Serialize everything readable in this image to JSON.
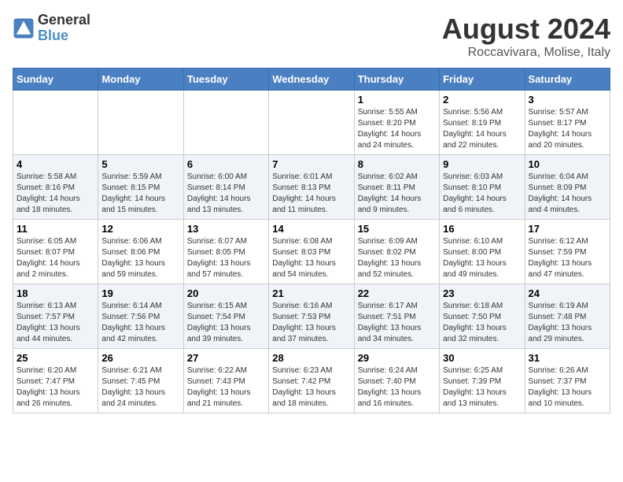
{
  "logo": {
    "text_general": "General",
    "text_blue": "Blue"
  },
  "header": {
    "title": "August 2024",
    "subtitle": "Roccavivara, Molise, Italy"
  },
  "columns": [
    "Sunday",
    "Monday",
    "Tuesday",
    "Wednesday",
    "Thursday",
    "Friday",
    "Saturday"
  ],
  "weeks": [
    [
      {
        "day": "",
        "info": ""
      },
      {
        "day": "",
        "info": ""
      },
      {
        "day": "",
        "info": ""
      },
      {
        "day": "",
        "info": ""
      },
      {
        "day": "1",
        "info": "Sunrise: 5:55 AM\nSunset: 8:20 PM\nDaylight: 14 hours\nand 24 minutes."
      },
      {
        "day": "2",
        "info": "Sunrise: 5:56 AM\nSunset: 8:19 PM\nDaylight: 14 hours\nand 22 minutes."
      },
      {
        "day": "3",
        "info": "Sunrise: 5:57 AM\nSunset: 8:17 PM\nDaylight: 14 hours\nand 20 minutes."
      }
    ],
    [
      {
        "day": "4",
        "info": "Sunrise: 5:58 AM\nSunset: 8:16 PM\nDaylight: 14 hours\nand 18 minutes."
      },
      {
        "day": "5",
        "info": "Sunrise: 5:59 AM\nSunset: 8:15 PM\nDaylight: 14 hours\nand 15 minutes."
      },
      {
        "day": "6",
        "info": "Sunrise: 6:00 AM\nSunset: 8:14 PM\nDaylight: 14 hours\nand 13 minutes."
      },
      {
        "day": "7",
        "info": "Sunrise: 6:01 AM\nSunset: 8:13 PM\nDaylight: 14 hours\nand 11 minutes."
      },
      {
        "day": "8",
        "info": "Sunrise: 6:02 AM\nSunset: 8:11 PM\nDaylight: 14 hours\nand 9 minutes."
      },
      {
        "day": "9",
        "info": "Sunrise: 6:03 AM\nSunset: 8:10 PM\nDaylight: 14 hours\nand 6 minutes."
      },
      {
        "day": "10",
        "info": "Sunrise: 6:04 AM\nSunset: 8:09 PM\nDaylight: 14 hours\nand 4 minutes."
      }
    ],
    [
      {
        "day": "11",
        "info": "Sunrise: 6:05 AM\nSunset: 8:07 PM\nDaylight: 14 hours\nand 2 minutes."
      },
      {
        "day": "12",
        "info": "Sunrise: 6:06 AM\nSunset: 8:06 PM\nDaylight: 13 hours\nand 59 minutes."
      },
      {
        "day": "13",
        "info": "Sunrise: 6:07 AM\nSunset: 8:05 PM\nDaylight: 13 hours\nand 57 minutes."
      },
      {
        "day": "14",
        "info": "Sunrise: 6:08 AM\nSunset: 8:03 PM\nDaylight: 13 hours\nand 54 minutes."
      },
      {
        "day": "15",
        "info": "Sunrise: 6:09 AM\nSunset: 8:02 PM\nDaylight: 13 hours\nand 52 minutes."
      },
      {
        "day": "16",
        "info": "Sunrise: 6:10 AM\nSunset: 8:00 PM\nDaylight: 13 hours\nand 49 minutes."
      },
      {
        "day": "17",
        "info": "Sunrise: 6:12 AM\nSunset: 7:59 PM\nDaylight: 13 hours\nand 47 minutes."
      }
    ],
    [
      {
        "day": "18",
        "info": "Sunrise: 6:13 AM\nSunset: 7:57 PM\nDaylight: 13 hours\nand 44 minutes."
      },
      {
        "day": "19",
        "info": "Sunrise: 6:14 AM\nSunset: 7:56 PM\nDaylight: 13 hours\nand 42 minutes."
      },
      {
        "day": "20",
        "info": "Sunrise: 6:15 AM\nSunset: 7:54 PM\nDaylight: 13 hours\nand 39 minutes."
      },
      {
        "day": "21",
        "info": "Sunrise: 6:16 AM\nSunset: 7:53 PM\nDaylight: 13 hours\nand 37 minutes."
      },
      {
        "day": "22",
        "info": "Sunrise: 6:17 AM\nSunset: 7:51 PM\nDaylight: 13 hours\nand 34 minutes."
      },
      {
        "day": "23",
        "info": "Sunrise: 6:18 AM\nSunset: 7:50 PM\nDaylight: 13 hours\nand 32 minutes."
      },
      {
        "day": "24",
        "info": "Sunrise: 6:19 AM\nSunset: 7:48 PM\nDaylight: 13 hours\nand 29 minutes."
      }
    ],
    [
      {
        "day": "25",
        "info": "Sunrise: 6:20 AM\nSunset: 7:47 PM\nDaylight: 13 hours\nand 26 minutes."
      },
      {
        "day": "26",
        "info": "Sunrise: 6:21 AM\nSunset: 7:45 PM\nDaylight: 13 hours\nand 24 minutes."
      },
      {
        "day": "27",
        "info": "Sunrise: 6:22 AM\nSunset: 7:43 PM\nDaylight: 13 hours\nand 21 minutes."
      },
      {
        "day": "28",
        "info": "Sunrise: 6:23 AM\nSunset: 7:42 PM\nDaylight: 13 hours\nand 18 minutes."
      },
      {
        "day": "29",
        "info": "Sunrise: 6:24 AM\nSunset: 7:40 PM\nDaylight: 13 hours\nand 16 minutes."
      },
      {
        "day": "30",
        "info": "Sunrise: 6:25 AM\nSunset: 7:39 PM\nDaylight: 13 hours\nand 13 minutes."
      },
      {
        "day": "31",
        "info": "Sunrise: 6:26 AM\nSunset: 7:37 PM\nDaylight: 13 hours\nand 10 minutes."
      }
    ]
  ]
}
